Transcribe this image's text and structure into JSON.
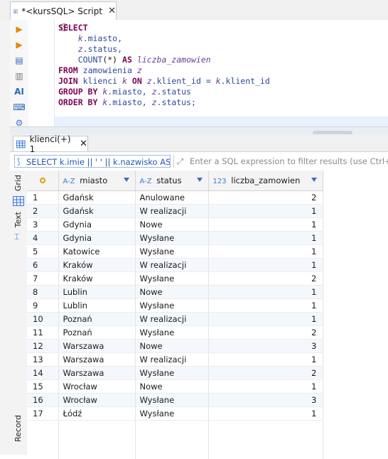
{
  "editor_tab": {
    "title": "*<kursSQL> Script"
  },
  "sql": {
    "lines": [
      [
        {
          "t": "SELECT",
          "c": "kw"
        }
      ],
      [
        {
          "t": "    "
        },
        {
          "t": "k",
          "c": "al"
        },
        {
          "t": ".miasto,",
          "c": "id"
        }
      ],
      [
        {
          "t": "    "
        },
        {
          "t": "z",
          "c": "al"
        },
        {
          "t": ".status,",
          "c": "id"
        }
      ],
      [
        {
          "t": "    "
        },
        {
          "t": "COUNT",
          "c": "id"
        },
        {
          "t": "(*) "
        },
        {
          "t": "AS",
          "c": "kw"
        },
        {
          "t": " "
        },
        {
          "t": "liczba_zamowien",
          "c": "al"
        }
      ],
      [
        {
          "t": "FROM",
          "c": "kw"
        },
        {
          "t": " "
        },
        {
          "t": "zamowienia",
          "c": "id"
        },
        {
          "t": " "
        },
        {
          "t": "z",
          "c": "al"
        }
      ],
      [
        {
          "t": "JOIN",
          "c": "kw"
        },
        {
          "t": " "
        },
        {
          "t": "klienci",
          "c": "id"
        },
        {
          "t": " "
        },
        {
          "t": "k",
          "c": "al"
        },
        {
          "t": " "
        },
        {
          "t": "ON",
          "c": "kw"
        },
        {
          "t": " "
        },
        {
          "t": "z",
          "c": "al"
        },
        {
          "t": ".klient_id = ",
          "c": "id"
        },
        {
          "t": "k",
          "c": "al"
        },
        {
          "t": ".klient_id",
          "c": "id"
        }
      ],
      [
        {
          "t": "GROUP BY",
          "c": "kw"
        },
        {
          "t": " "
        },
        {
          "t": "k",
          "c": "al"
        },
        {
          "t": ".miasto, ",
          "c": "id"
        },
        {
          "t": "z",
          "c": "al"
        },
        {
          "t": ".status",
          "c": "id"
        }
      ],
      [
        {
          "t": "ORDER BY",
          "c": "kw"
        },
        {
          "t": " "
        },
        {
          "t": "k",
          "c": "al"
        },
        {
          "t": ".miasto, ",
          "c": "id"
        },
        {
          "t": "z",
          "c": "al"
        },
        {
          "t": ".status;",
          "c": "id"
        }
      ]
    ]
  },
  "results_tab": {
    "title": "klienci(+) 1"
  },
  "filter": {
    "query_text": "SELECT k.imie || ' ' || k.nazwisko AS klie",
    "placeholder": "Enter a SQL expression to filter results (use Ctrl+Space)"
  },
  "side_tabs": {
    "grid": "Grid",
    "text": "Text",
    "record": "Record"
  },
  "grid": {
    "columns": [
      {
        "type": "A-Z",
        "name": "miasto"
      },
      {
        "type": "A-Z",
        "name": "status"
      },
      {
        "type": "123",
        "name": "liczba_zamowien"
      }
    ],
    "rows": [
      [
        "1",
        "Gdańsk",
        "Anulowane",
        "2"
      ],
      [
        "2",
        "Gdańsk",
        "W realizacji",
        "1"
      ],
      [
        "3",
        "Gdynia",
        "Nowe",
        "1"
      ],
      [
        "4",
        "Gdynia",
        "Wysłane",
        "1"
      ],
      [
        "5",
        "Katowice",
        "Wysłane",
        "1"
      ],
      [
        "6",
        "Kraków",
        "W realizacji",
        "1"
      ],
      [
        "7",
        "Kraków",
        "Wysłane",
        "2"
      ],
      [
        "8",
        "Lublin",
        "Nowe",
        "1"
      ],
      [
        "9",
        "Lublin",
        "Wysłane",
        "1"
      ],
      [
        "10",
        "Poznań",
        "W realizacji",
        "1"
      ],
      [
        "11",
        "Poznań",
        "Wysłane",
        "2"
      ],
      [
        "12",
        "Warszawa",
        "Nowe",
        "3"
      ],
      [
        "13",
        "Warszawa",
        "W realizacji",
        "1"
      ],
      [
        "14",
        "Warszawa",
        "Wysłane",
        "2"
      ],
      [
        "15",
        "Wrocław",
        "Nowe",
        "1"
      ],
      [
        "16",
        "Wrocław",
        "Wysłane",
        "3"
      ],
      [
        "17",
        "Łódź",
        "Wysłane",
        "1"
      ]
    ]
  }
}
